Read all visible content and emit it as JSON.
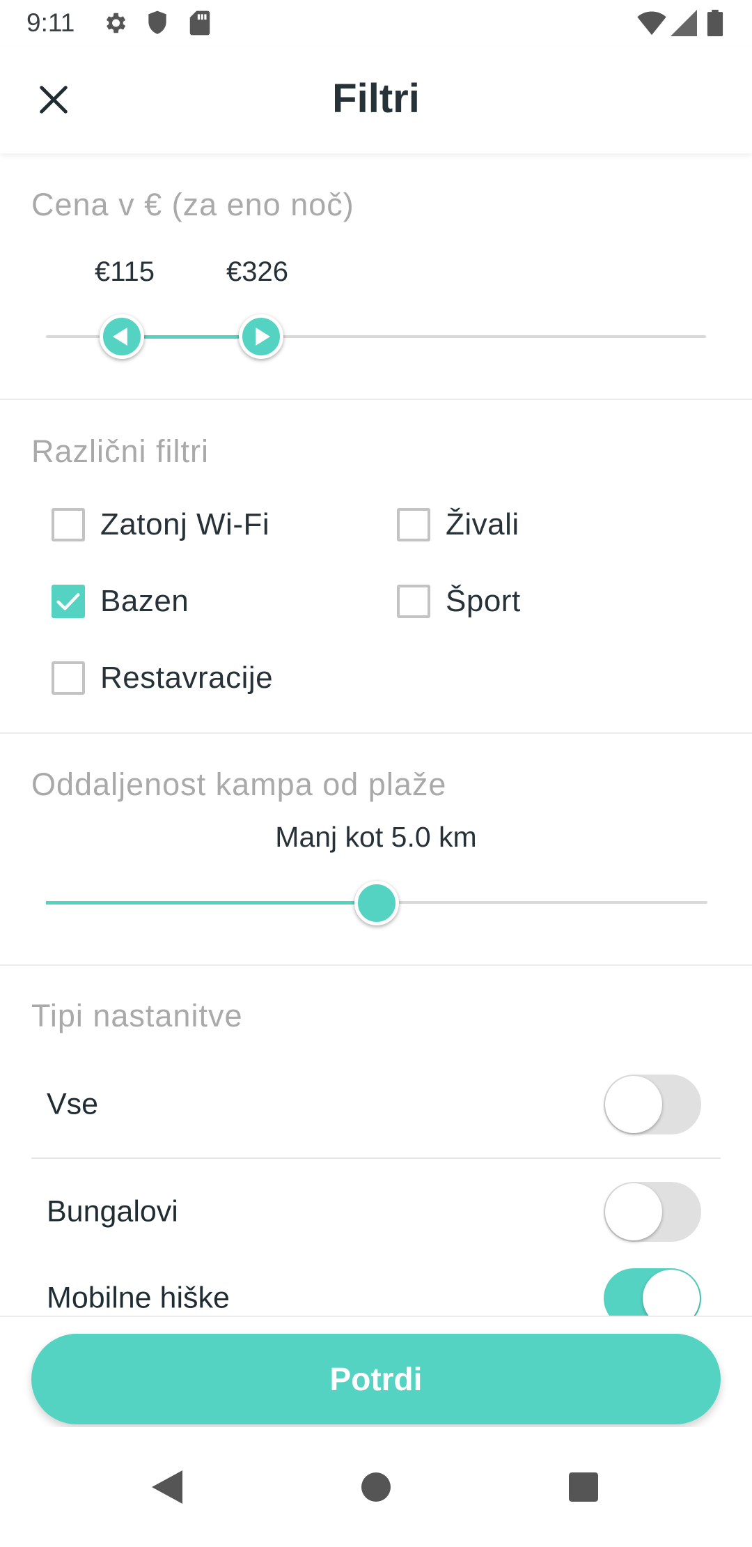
{
  "status_bar": {
    "time": "9:11",
    "left_icons": [
      "gear-icon",
      "shield-icon",
      "sd-card-icon"
    ],
    "right_icons": [
      "wifi-icon",
      "signal-icon",
      "battery-icon"
    ]
  },
  "header": {
    "title": "Filtri",
    "close_icon": "close-icon"
  },
  "price": {
    "heading": "Cena v € (za eno noč)",
    "min_label": "€115",
    "max_label": "€326",
    "min_fraction": 0.115,
    "max_fraction": 0.326
  },
  "filters": {
    "heading": "Različni filtri",
    "items": [
      {
        "label": "Zatonj Wi-Fi",
        "checked": false
      },
      {
        "label": "Živali",
        "checked": false
      },
      {
        "label": "Bazen",
        "checked": true
      },
      {
        "label": "Šport",
        "checked": false
      },
      {
        "label": "Restavracije",
        "checked": false
      }
    ]
  },
  "distance": {
    "heading": "Oddaljenost kampa od plaže",
    "label": "Manj kot 5.0 km",
    "fraction": 0.5
  },
  "accommodation": {
    "heading": "Tipi nastanitve",
    "items": [
      {
        "label": "Vse",
        "on": false
      },
      {
        "label": "Bungalovi",
        "on": false
      },
      {
        "label": "Mobilne hiške",
        "on": true
      }
    ]
  },
  "confirm": {
    "label": "Potrdi"
  },
  "colors": {
    "accent": "#54d3c2",
    "text": "#263238",
    "muted": "#a9a9a9"
  },
  "nav": {
    "back_icon": "back-triangle-icon",
    "home_icon": "home-circle-icon",
    "recents_icon": "recents-square-icon"
  }
}
